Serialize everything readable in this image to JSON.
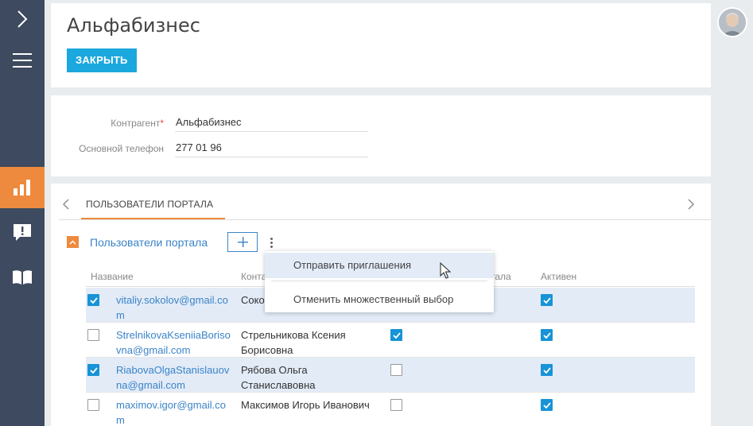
{
  "page": {
    "title": "Альфабизнес",
    "close_label": "ЗАКРЫТЬ"
  },
  "fields": {
    "account_label": "Контрагент",
    "account_required": "*",
    "account_value": "Альфабизнес",
    "phone_label": "Основной телефон",
    "phone_value": "277 01 96"
  },
  "tabs": {
    "active_label": "ПОЛЬЗОВАТЕЛИ ПОРТАЛА"
  },
  "detail": {
    "title": "Пользователи портала",
    "columns": {
      "name": "Название",
      "contact": "Конта",
      "portal": "тала",
      "active": "Активен"
    },
    "rows": [
      {
        "email": "vitaliy.sokolov@gmail.com",
        "contact": "Соко Петрович",
        "selected": true,
        "portal_user": null,
        "active": true
      },
      {
        "email": "StrelnikovaKseniiaBorisovna@gmail.com",
        "contact": "Стрельникова Ксения Борисовна",
        "selected": false,
        "portal_user": true,
        "active": true
      },
      {
        "email": "RiabovaOlgaStanislauovna@gmail.com",
        "contact": "Рябова Ольга Станиславовна",
        "selected": true,
        "portal_user": false,
        "active": true
      },
      {
        "email": "maximov.igor@gmail.com",
        "contact": "Максимов Игорь Иванович",
        "selected": false,
        "portal_user": false,
        "active": true
      }
    ]
  },
  "context_menu": {
    "items": [
      {
        "label": "Отправить приглашения"
      },
      {
        "label": "Отменить множественный выбор"
      }
    ]
  },
  "colors": {
    "sidebar": "#3d4a5f",
    "accent_orange": "#ee8a3d",
    "primary_button": "#1ba8de",
    "link": "#3a84c8",
    "checkbox_checked": "#1793d6",
    "selected_row": "#e3ebf7"
  }
}
